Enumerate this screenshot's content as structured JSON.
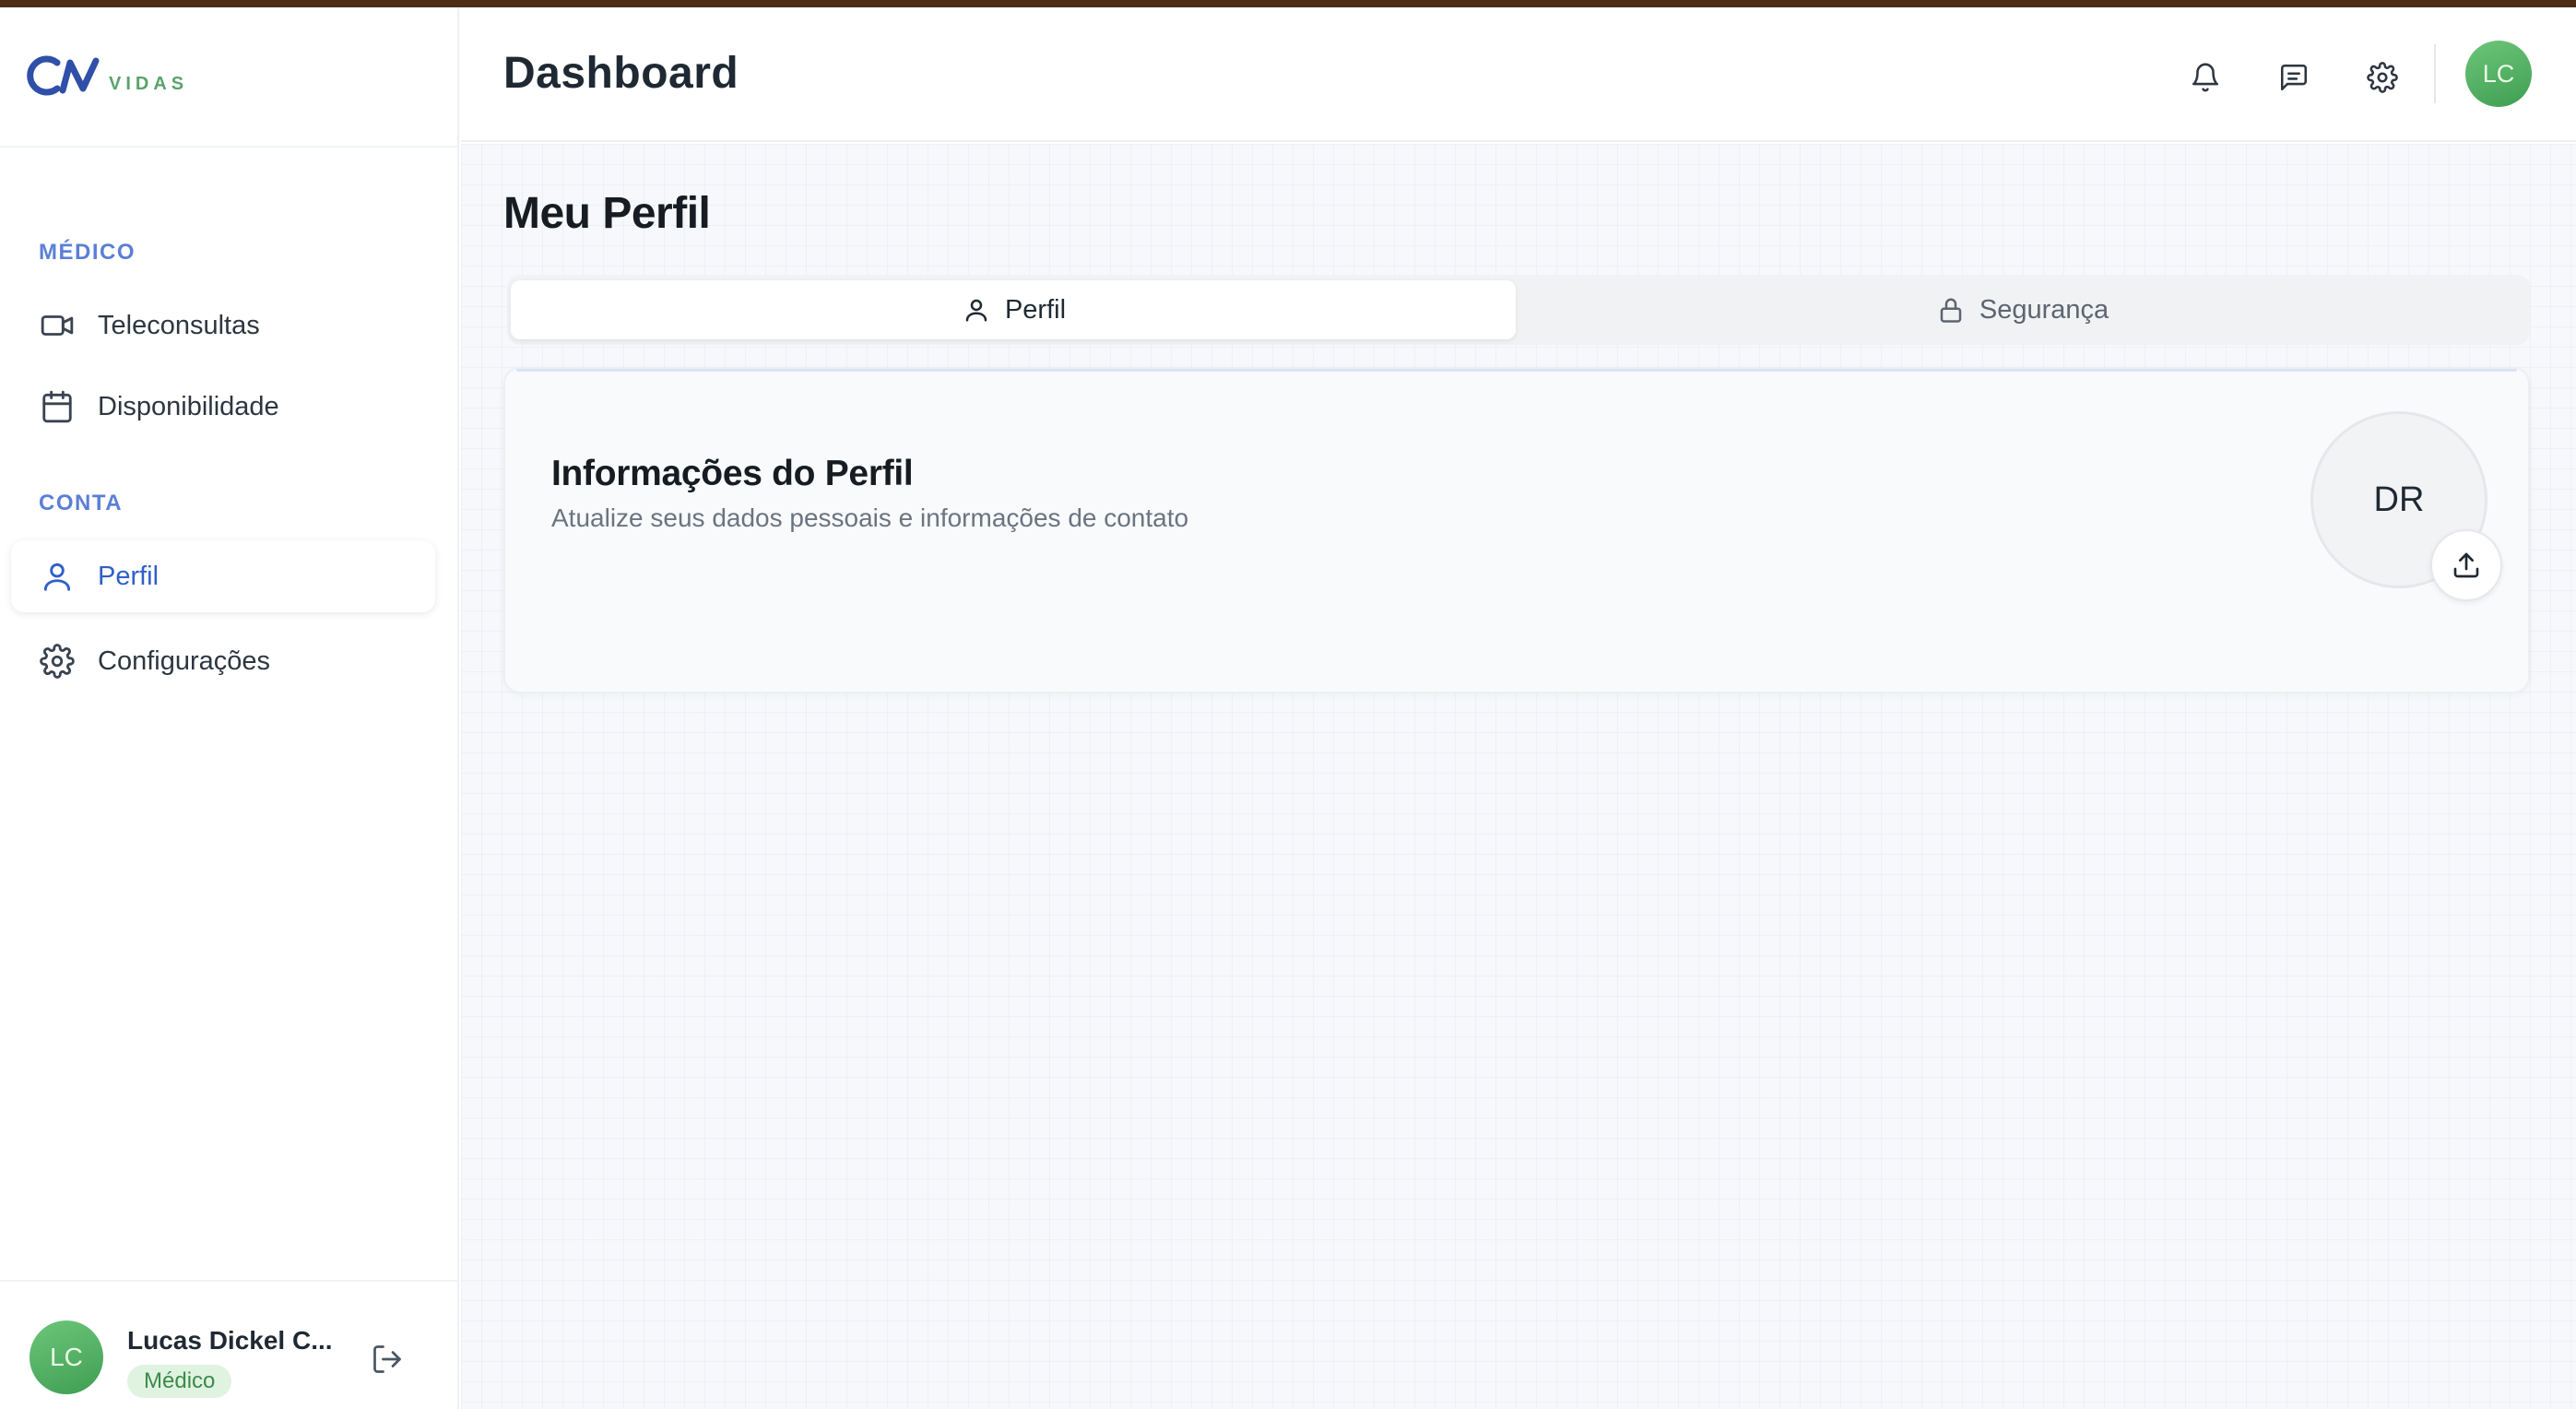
{
  "brand": {
    "logo_text": "VIDAS",
    "colors": {
      "primary": "#2f4fa8",
      "green": "#4caf5f"
    }
  },
  "header": {
    "title": "Dashboard",
    "avatar_initials": "LC"
  },
  "sidebar": {
    "sections": [
      {
        "label": "MÉDICO",
        "items": [
          {
            "label": "Teleconsultas",
            "icon": "video-icon"
          },
          {
            "label": "Disponibilidade",
            "icon": "calendar-icon"
          }
        ]
      },
      {
        "label": "CONTA",
        "items": [
          {
            "label": "Perfil",
            "icon": "user-icon",
            "active": true
          },
          {
            "label": "Configurações",
            "icon": "gear-icon"
          }
        ]
      }
    ],
    "user": {
      "initials": "LC",
      "name": "Lucas Dickel C...",
      "role": "Médico"
    }
  },
  "main": {
    "page_title": "Meu Perfil",
    "tabs": [
      {
        "label": "Perfil",
        "icon": "user-icon",
        "active": true
      },
      {
        "label": "Segurança",
        "icon": "lock-icon",
        "active": false
      }
    ],
    "card": {
      "title": "Informações do Perfil",
      "subtitle": "Atualize seus dados pessoais e informações de contato",
      "avatar_initials": "DR"
    }
  }
}
